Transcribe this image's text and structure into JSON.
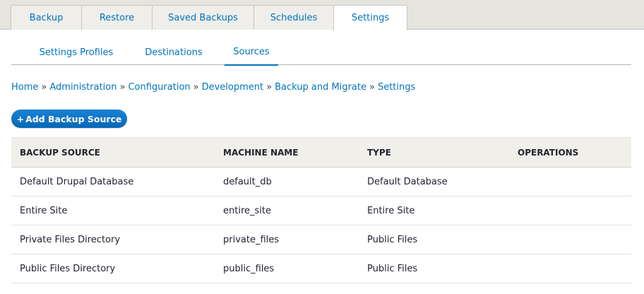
{
  "primary_tabs": [
    {
      "label": "Backup",
      "active": false
    },
    {
      "label": "Restore",
      "active": false
    },
    {
      "label": "Saved Backups",
      "active": false
    },
    {
      "label": "Schedules",
      "active": false
    },
    {
      "label": "Settings",
      "active": true
    }
  ],
  "secondary_tabs": [
    {
      "label": "Settings Profiles",
      "active": false
    },
    {
      "label": "Destinations",
      "active": false
    },
    {
      "label": "Sources",
      "active": true
    }
  ],
  "breadcrumb": [
    {
      "label": "Home"
    },
    {
      "label": "Administration"
    },
    {
      "label": "Configuration"
    },
    {
      "label": "Development"
    },
    {
      "label": "Backup and Migrate"
    },
    {
      "label": "Settings"
    }
  ],
  "breadcrumb_separator": "»",
  "add_button": {
    "icon": "+",
    "label": "Add Backup Source"
  },
  "table": {
    "headers": [
      "BACKUP SOURCE",
      "MACHINE NAME",
      "TYPE",
      "OPERATIONS"
    ],
    "rows": [
      [
        "Default Drupal Database",
        "default_db",
        "Default Database",
        ""
      ],
      [
        "Entire Site",
        "entire_site",
        "Entire Site",
        ""
      ],
      [
        "Private Files Directory",
        "private_files",
        "Public Files",
        ""
      ],
      [
        "Public Files Directory",
        "public_files",
        "Public Files",
        ""
      ]
    ]
  },
  "colors": {
    "link": "#0074bd",
    "button": "#0a6fc2",
    "tab_bar": "#e6e4df",
    "table_header": "#f0efea"
  }
}
